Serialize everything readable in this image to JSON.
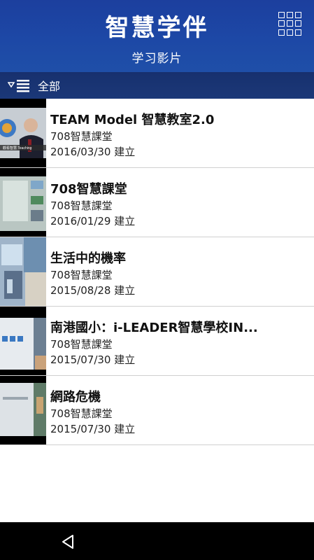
{
  "header": {
    "app_title": "智慧学伴",
    "subtitle": "学习影片",
    "menu_icon": "grid-menu-icon"
  },
  "filter": {
    "label": "全部",
    "icon": "filter-list-icon"
  },
  "videos": [
    {
      "title": "TEAM Model 智慧教室2.0",
      "channel": "708智慧課堂",
      "date": "2016/03/30",
      "created_label": "建立",
      "thumb_text": "觀看智慧 Teaching"
    },
    {
      "title": "708智慧課堂",
      "channel": "708智慧課堂",
      "date": "2016/01/29",
      "created_label": "建立",
      "thumb_text": ""
    },
    {
      "title": "生活中的機率",
      "channel": "708智慧課堂",
      "date": "2015/08/28",
      "created_label": "建立",
      "thumb_text": ""
    },
    {
      "title": "南港國小：i-LEADER智慧學校IN...",
      "channel": "708智慧課堂",
      "date": "2015/07/30",
      "created_label": "建立",
      "thumb_text": ""
    },
    {
      "title": "網路危機",
      "channel": "708智慧課堂",
      "date": "2015/07/30",
      "created_label": "建立",
      "thumb_text": ""
    }
  ],
  "nav": {
    "back_icon": "back-triangle-icon"
  },
  "colors": {
    "header": "#1d48a6",
    "filter_bar": "#1b3878",
    "divider": "#d0d0d0"
  }
}
